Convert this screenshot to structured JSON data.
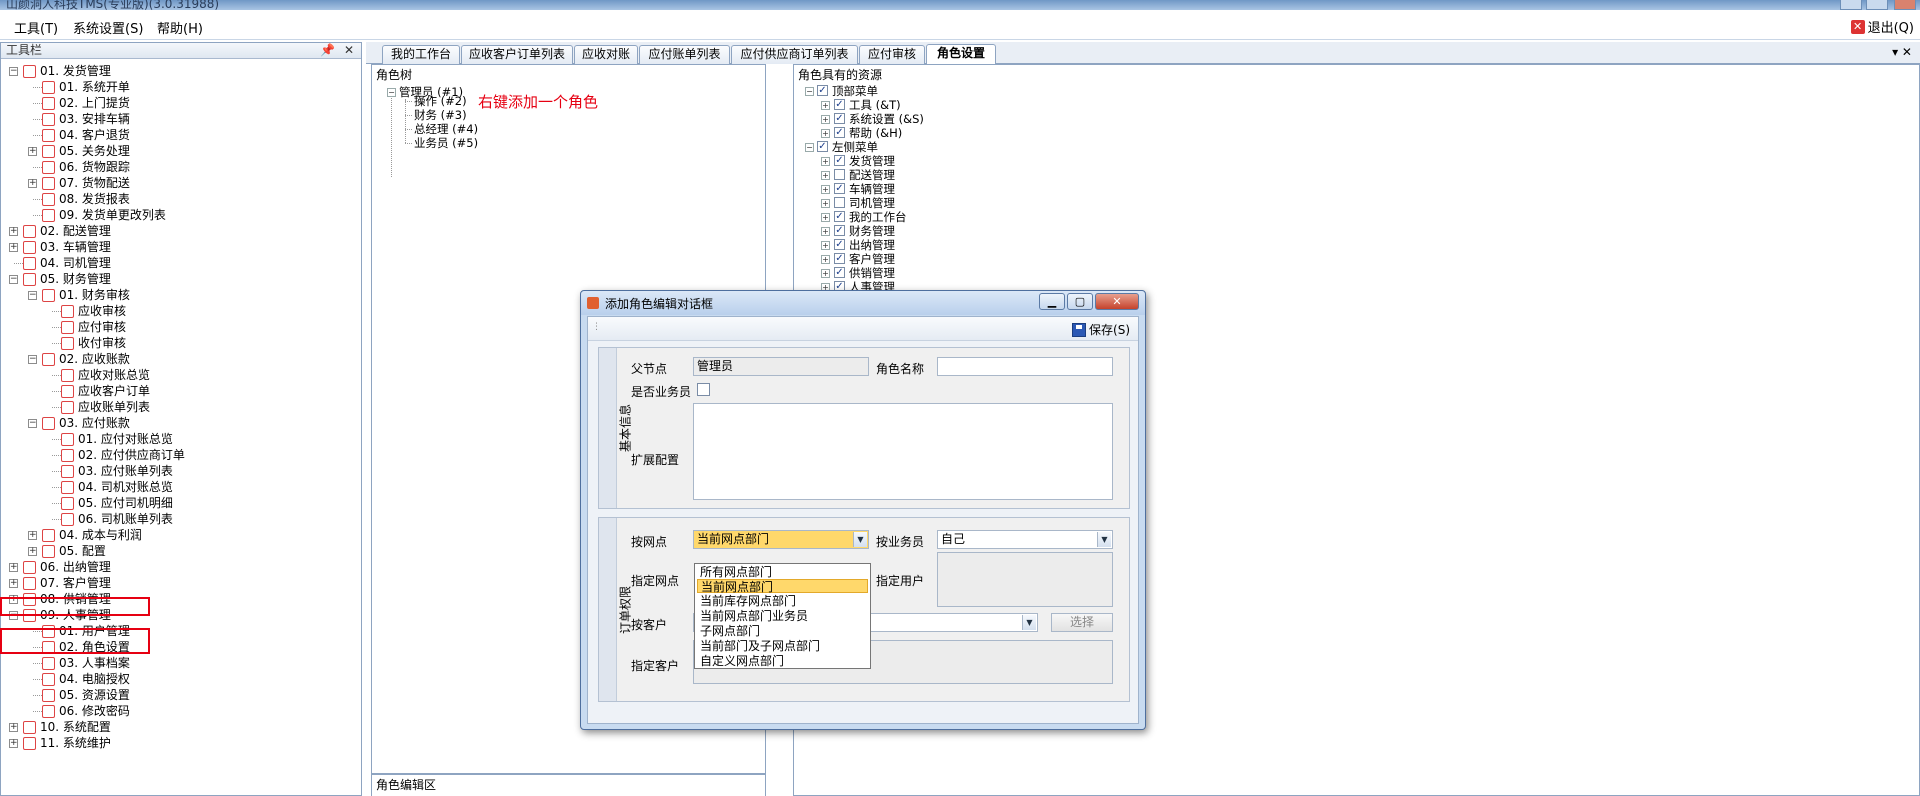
{
  "window": {
    "title": "山颜洞人科技TMS(专业版)(3.0.31988)"
  },
  "menu": {
    "items": [
      "工具(T)",
      "系统设置(S)",
      "帮助(H)"
    ],
    "exit_label": "退出(Q)"
  },
  "toolbar_panel": {
    "title": "工具栏",
    "pin_icon": "📌",
    "close_icon": "✕"
  },
  "nav": [
    {
      "label": "01. 发货管理"
    },
    {
      "label": "01. 系统开单"
    },
    {
      "label": "02. 上门提货"
    },
    {
      "label": "03. 安排车辆"
    },
    {
      "label": "04. 客户退货"
    },
    {
      "label": "05. 关务处理"
    },
    {
      "label": "06. 货物跟踪"
    },
    {
      "label": "07. 货物配送"
    },
    {
      "label": "08. 发货报表"
    },
    {
      "label": "09. 发货单更改列表"
    },
    {
      "label": "02. 配送管理"
    },
    {
      "label": "03. 车辆管理"
    },
    {
      "label": "04. 司机管理"
    },
    {
      "label": "05. 财务管理"
    },
    {
      "label": "01. 财务审核"
    },
    {
      "label": "应收审核"
    },
    {
      "label": "应付审核"
    },
    {
      "label": "收付审核"
    },
    {
      "label": "02. 应收账款"
    },
    {
      "label": "应收对账总览"
    },
    {
      "label": "应收客户订单"
    },
    {
      "label": "应收账单列表"
    },
    {
      "label": "03. 应付账款"
    },
    {
      "label": "01. 应付对账总览"
    },
    {
      "label": "02. 应付供应商订单"
    },
    {
      "label": "03. 应付账单列表"
    },
    {
      "label": "04. 司机对账总览"
    },
    {
      "label": "05. 应付司机明细"
    },
    {
      "label": "06. 司机账单列表"
    },
    {
      "label": "04. 成本与利润"
    },
    {
      "label": "05. 配置"
    },
    {
      "label": "06. 出纳管理"
    },
    {
      "label": "07. 客户管理"
    },
    {
      "label": "08. 供销管理"
    },
    {
      "label": "09. 人事管理"
    },
    {
      "label": "01. 用户管理"
    },
    {
      "label": "02. 角色设置"
    },
    {
      "label": "03. 人事档案"
    },
    {
      "label": "04. 电脑授权"
    },
    {
      "label": "05. 资源设置"
    },
    {
      "label": "06. 修改密码"
    },
    {
      "label": "10. 系统配置"
    },
    {
      "label": "11. 系统维护"
    }
  ],
  "tabs": [
    "我的工作台",
    "应收客户订单列表",
    "应收对账",
    "应付账单列表",
    "应付供应商订单列表",
    "应付审核",
    "角色设置"
  ],
  "tab_controls": "▾ ✕",
  "role_tree": {
    "title": "角色树",
    "root": "管理员 (#1)",
    "children": [
      "操作 (#2)",
      "财务 (#3)",
      "总经理 (#4)",
      "业务员 (#5)"
    ],
    "annotation": "右键添加一个角色",
    "edit_title": "角色编辑区"
  },
  "resources": {
    "title": "角色具有的资源",
    "top_menu": "顶部菜单",
    "top_items": [
      "工具 (&T)",
      "系统设置 (&S)",
      "帮助 (&H)"
    ],
    "left_menu": "左侧菜单",
    "left_items": [
      "发货管理",
      "配送管理",
      "车辆管理",
      "司机管理",
      "我的工作台",
      "财务管理",
      "出纳管理",
      "客户管理",
      "供销管理",
      "人事管理"
    ],
    "left_checked": [
      true,
      false,
      true,
      false,
      true,
      true,
      true,
      true,
      true,
      true
    ]
  },
  "dialog": {
    "title": "添加角色编辑对话框",
    "save_label": "保存(S)",
    "basic_group": "基本信息",
    "parent_label": "父节点",
    "parent_value": "管理员",
    "role_name_label": "角色名称",
    "role_name_value": "",
    "is_salesman_label": "是否业务员",
    "ext_config_label": "扩展配置",
    "order_group": "订单权限",
    "by_branch_label": "按网点",
    "by_branch_value": "当前网点部门",
    "by_salesman_label": "按业务员",
    "by_salesman_value": "自己",
    "assign_branch_label": "指定网点",
    "assign_user_label": "指定用户",
    "by_customer_label": "按客户",
    "select_label": "选择",
    "assign_customer_label": "指定客户",
    "options": [
      "所有网点部门",
      "当前网点部门",
      "当前库存网点部门",
      "当前网点部门业务员",
      "子网点部门",
      "当前部门及子网点部门",
      "自定义网点部门"
    ],
    "selected_option": 1
  },
  "colors": {
    "accent_red": "#e60012",
    "highlight": "#ffd86b",
    "border_blue": "#8ea4c1"
  }
}
